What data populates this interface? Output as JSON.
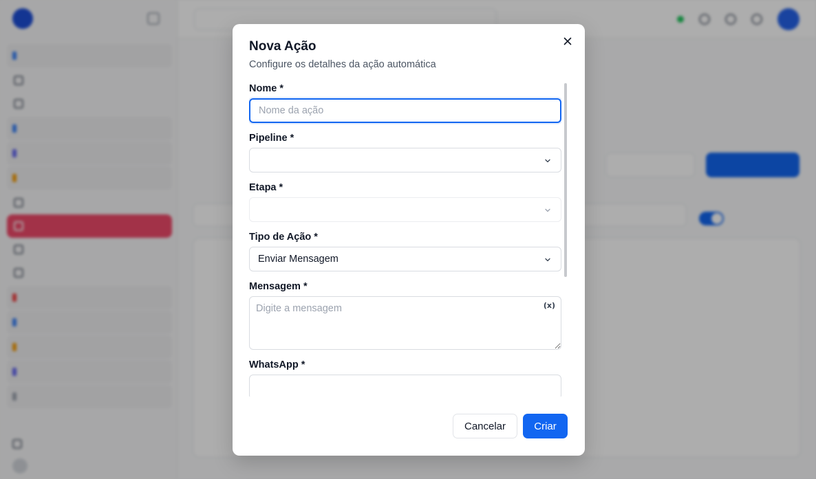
{
  "modal": {
    "title": "Nova Ação",
    "description": "Configure os detalhes da ação automática",
    "fields": {
      "name": {
        "label": "Nome *",
        "placeholder": "Nome da ação",
        "value": ""
      },
      "pipeline": {
        "label": "Pipeline *",
        "value": ""
      },
      "stage": {
        "label": "Etapa *",
        "value": ""
      },
      "action_type": {
        "label": "Tipo de Ação *",
        "value": "Enviar Mensagem"
      },
      "message": {
        "label": "Mensagem *",
        "placeholder": "Digite a mensagem",
        "variable_icon": "(x)"
      },
      "whatsapp": {
        "label": "WhatsApp *"
      }
    },
    "buttons": {
      "cancel": "Cancelar",
      "create": "Criar"
    }
  },
  "icons": {
    "close": "close-icon",
    "chevron": "chevron-down-icon",
    "variable": "variable-icon"
  },
  "colors": {
    "primary": "#1266f1",
    "active_nav": "#ef4a6a",
    "overlay": "rgba(0,0,0,0.32)"
  }
}
